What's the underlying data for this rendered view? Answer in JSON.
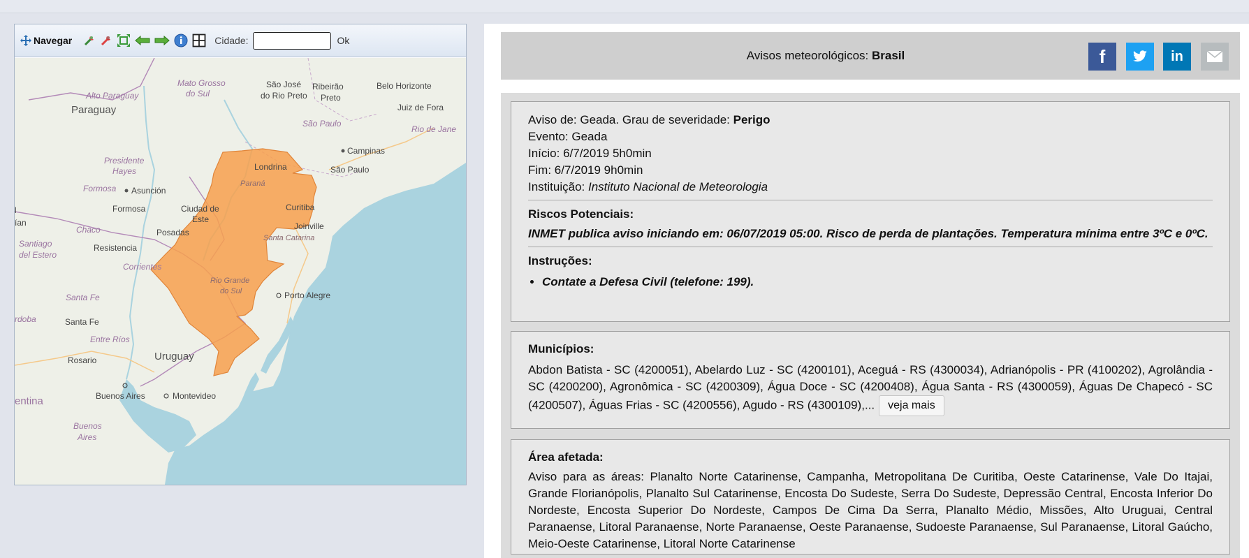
{
  "toolbar": {
    "navigate_label": "Navegar",
    "city_label": "Cidade:",
    "city_value": "",
    "ok_label": "Ok"
  },
  "map": {
    "labels": {
      "paraguay": "Paraguay",
      "alto_paraguay": "Alto Paraguay",
      "mato_grosso": "Mato Grosso",
      "do_sul": "do Sul",
      "sao_jose": "São José",
      "do_rio_preto": "do Rio Preto",
      "ribeirao": "Ribeirão",
      "preto": "Preto",
      "belo_horizonte": "Belo Horizonte",
      "juiz_de_fora": "Juiz de Fora",
      "sao_paulo_state": "São Paulo",
      "campinas": "Campinas",
      "rio_de_jane": "Rio de Jane",
      "sao_paulo": "São Paulo",
      "presidente": "Presidente",
      "hayes": "Hayes",
      "londrina": "Londrina",
      "parana": "Paraná",
      "formosa_state": "Formosa",
      "asuncion": "Asunción",
      "formosa": "Formosa",
      "ciudad_de": "Ciudad de",
      "este": "Este",
      "curitiba": "Curitiba",
      "chaco": "Chaco",
      "joinville": "Joinville",
      "posadas": "Posadas",
      "santa_catarina": "Santa Catarina",
      "santiago": "Santiago",
      "del_estero": "del Estero",
      "resistencia": "Resistencia",
      "corrientes": "Corrientes",
      "rio_grande": "Rio Grande",
      "do_sul2": "do Sul",
      "porto_alegre": "Porto Alegre",
      "santa_fe_state": "Santa Fe",
      "rdoba": "rdoba",
      "santa_fe": "Santa Fe",
      "entre_rios": "Entre Ríos",
      "uruguay": "Uruguay",
      "rosario": "Rosario",
      "buenos_aires": "Buenos Aires",
      "montevideo": "Montevideo",
      "entina": "entina",
      "buenos_aires_state": "Buenos",
      "aires": "Aires",
      "an": "ían",
      "l": "l"
    },
    "warning_color": "#f7a04e"
  },
  "header": {
    "title_prefix": "Avisos meteorológicos:",
    "title_bold": "Brasil",
    "social": [
      "facebook-icon",
      "twitter-icon",
      "linkedin-icon",
      "email-icon"
    ]
  },
  "warning": {
    "aviso_prefix": "Aviso de: Geada. Grau de severidade:",
    "severity": "Perigo",
    "evento": "Evento: Geada",
    "inicio": "Início: 6/7/2019 5h0min",
    "fim": "Fim: 6/7/2019 9h0min",
    "instituicao_prefix": "Instituição:",
    "instituicao": "Instituto Nacional de Meteorologia",
    "riscos_title": "Riscos Potenciais:",
    "riscos_text": "INMET publica aviso iniciando em: 06/07/2019 05:00. Risco de perda de plantações. Temperatura mínima entre 3ºC e 0ºC.",
    "instrucoes_title": "Instruções:",
    "instrucoes": [
      "Contate a Defesa Civil (telefone: 199)."
    ]
  },
  "municipios": {
    "title": "Municípios:",
    "text": "Abdon Batista - SC (4200051), Abelardo Luz - SC (4200101), Aceguá - RS (4300034), Adrianópolis - PR (4100202), Agrolândia - SC (4200200), Agronômica - SC (4200309), Água Doce - SC (4200408), Água Santa - RS (4300059), Águas De Chapecó - SC (4200507), Águas Frias - SC (4200556), Agudo - RS (4300109),...",
    "more_label": "veja mais"
  },
  "area": {
    "title": "Área afetada:",
    "text": "Aviso para as áreas: Planalto Norte Catarinense, Campanha, Metropolitana De Curitiba, Oeste Catarinense, Vale Do Itajai, Grande Florianópolis, Planalto Sul Catarinense, Encosta Do Sudeste, Serra Do Sudeste, Depressão Central, Encosta Inferior Do Nordeste, Encosta Superior Do Nordeste, Campos De Cima Da Serra, Planalto Médio, Missões, Alto Uruguai, Central Paranaense, Litoral Paranaense, Norte Paranaense, Oeste Paranaense, Sudoeste Paranaense, Sul Paranaense, Litoral Gaúcho, Meio-Oeste Catarinense, Litoral Norte Catarinense"
  }
}
